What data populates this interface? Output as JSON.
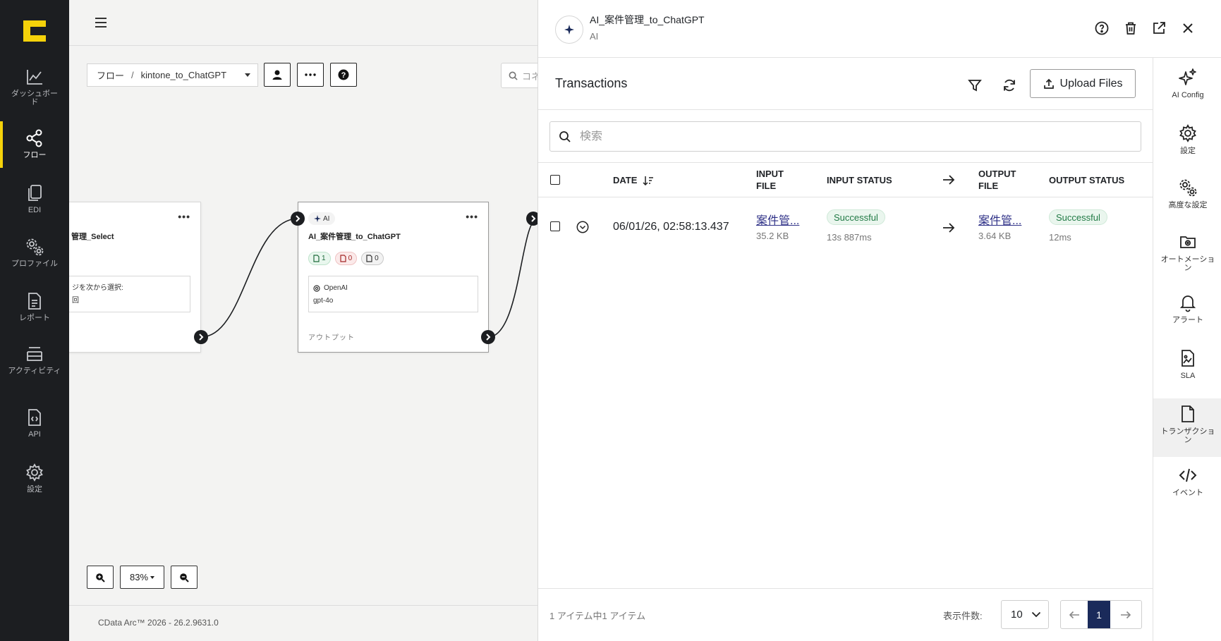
{
  "nav": {
    "items": [
      {
        "label": "ダッシュボード",
        "icon": "chart-line-icon"
      },
      {
        "label": "フロー",
        "icon": "flow-share-icon"
      },
      {
        "label": "EDI",
        "icon": "documents-icon"
      },
      {
        "label": "プロファイル",
        "icon": "gears-icon"
      },
      {
        "label": "レポート",
        "icon": "report-icon"
      },
      {
        "label": "アクティビティ",
        "icon": "activity-icon"
      },
      {
        "label": "API",
        "icon": "api-icon"
      },
      {
        "label": "設定",
        "icon": "gear-icon"
      }
    ],
    "active": "フロー",
    "accent": "#f5d20a"
  },
  "canvas": {
    "breadcrumb_root": "フロー",
    "breadcrumb_sep": "/",
    "flow_name": "kintone_to_ChatGPT",
    "search_placeholder": "コネ",
    "zoom": "83%",
    "footer": "CData Arc™ 2026 - 26.2.9631.0",
    "left_node": {
      "title": "管理_Select",
      "box_line1": "ジを次から選択:",
      "box_line2": "回",
      "menu": "•••"
    },
    "ai_node": {
      "tag": "AI",
      "title": "AI_案件管理_to_ChatGPT",
      "count_success": "1",
      "count_error": "0",
      "count_pending": "0",
      "provider": "OpenAI",
      "model": "gpt-4o",
      "footer": "アウトプット",
      "menu": "•••"
    }
  },
  "drawer": {
    "title": "AI_案件管理_to_ChatGPT",
    "subtitle": "AI",
    "section_title": "Transactions",
    "upload_label": "Upload Files",
    "search_placeholder": "検索",
    "columns": {
      "date": "DATE",
      "input_file": [
        "INPUT",
        "FILE"
      ],
      "input_status": "INPUT STATUS",
      "output_file": [
        "OUTPUT",
        "FILE"
      ],
      "output_status": "OUTPUT STATUS"
    },
    "rows": [
      {
        "date": "06/01/26, 02:58:13.437",
        "input_file": "案件管...",
        "input_size": "35.2 KB",
        "input_status": "Successful",
        "input_time": "13s 887ms",
        "output_file": "案件管...",
        "output_size": "3.64 KB",
        "output_status": "Successful",
        "output_time": "12ms"
      }
    ],
    "pagination": {
      "summary": "1 アイテム中1 アイテム",
      "page_size_label": "表示件数:",
      "page_size": "10",
      "current_page": "1"
    },
    "rail": [
      {
        "label": "AI Config",
        "icon": "sparkles-icon"
      },
      {
        "label": "設定",
        "icon": "gear-icon"
      },
      {
        "label": "高度な設定",
        "icon": "gears-icon"
      },
      {
        "label": "オートメーション",
        "icon": "automation-icon"
      },
      {
        "label": "アラート",
        "icon": "bell-icon"
      },
      {
        "label": "SLA",
        "icon": "sla-icon"
      },
      {
        "label": "トランザクション",
        "icon": "file-icon"
      },
      {
        "label": "イベント",
        "icon": "code-icon"
      }
    ],
    "rail_active": "トランザクション",
    "status_color": "#217a45",
    "link_color": "#2d2f86"
  }
}
